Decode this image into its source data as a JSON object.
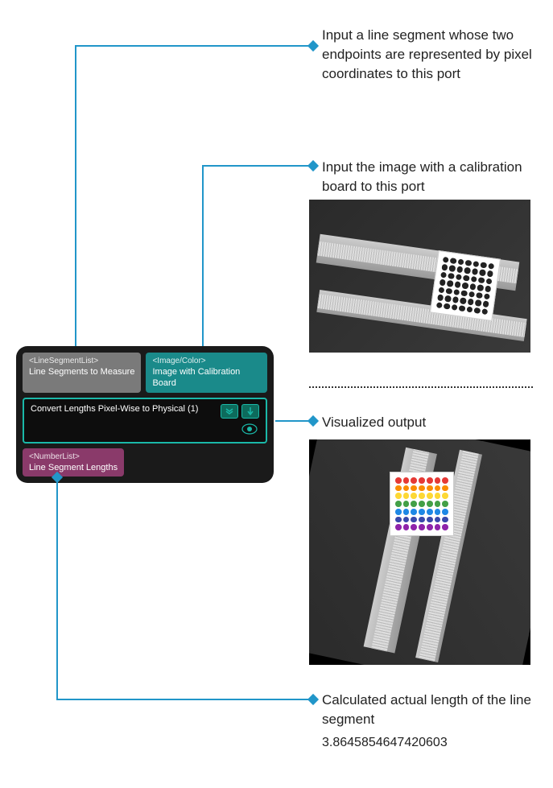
{
  "callouts": {
    "top": "Input a line segment whose two endpoints are represented by pixel coordinates to this port",
    "image_in": "Input the image with a calibration board to this port",
    "viz_out": "Visualized output",
    "length_out": "Calculated actual length of the line segment"
  },
  "node": {
    "port_in_left": {
      "type": "<LineSegmentList>",
      "name": "Line Segments to Measure"
    },
    "port_in_right": {
      "type": "<Image/Color>",
      "name": "Image with Calibration Board"
    },
    "title": "Convert Lengths Pixel-Wise to Physical (1)",
    "port_out": {
      "type": "<NumberList>",
      "name": "Line Segment Lengths"
    }
  },
  "output_value": "3.8645854647420603"
}
